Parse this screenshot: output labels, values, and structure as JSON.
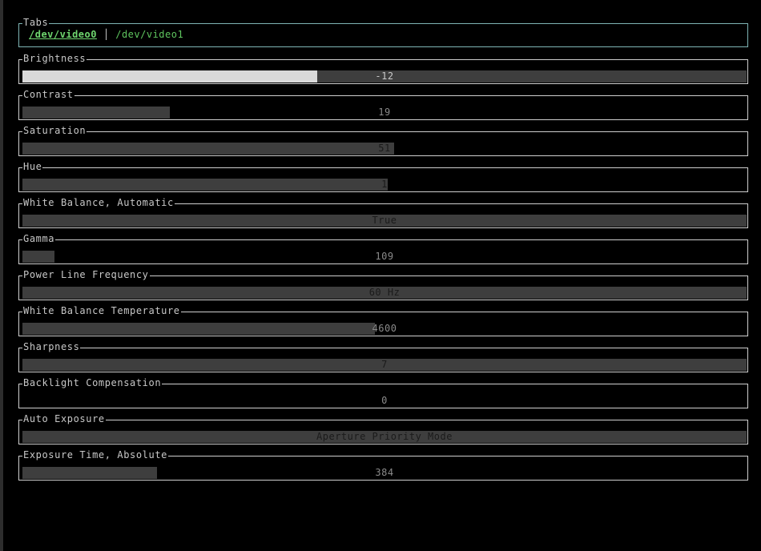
{
  "tabs": {
    "title": "Tabs",
    "items": [
      {
        "label": "/dev/video0",
        "active": true
      },
      {
        "label": "/dev/video1",
        "active": false
      }
    ]
  },
  "controls": [
    {
      "title": "Brightness",
      "value": "-12",
      "fill": 0.407
    },
    {
      "title": "Contrast",
      "value": "19",
      "fill": 0.204
    },
    {
      "title": "Saturation",
      "value": "51",
      "fill": 0.513
    },
    {
      "title": "Hue",
      "value": "1",
      "fill": 0.504
    },
    {
      "title": "White Balance, Automatic",
      "value": "True",
      "fill": 1.0
    },
    {
      "title": "Gamma",
      "value": "109",
      "fill": 0.044
    },
    {
      "title": "Power Line Frequency",
      "value": "60 Hz",
      "fill": 1.0
    },
    {
      "title": "White Balance Temperature",
      "value": "4600",
      "fill": 0.487
    },
    {
      "title": "Sharpness",
      "value": "7",
      "fill": 1.0
    },
    {
      "title": "Backlight Compensation",
      "value": "0",
      "fill": 0.0
    },
    {
      "title": "Auto Exposure",
      "value": "Aperture Priority Mode",
      "fill": 1.0
    },
    {
      "title": "Exposure Time, Absolute",
      "value": "384",
      "fill": 0.186
    }
  ],
  "colors": {
    "background": "#000000",
    "border": "#cfcfcf",
    "tabs_border": "#7fb5b5",
    "tab_text": "#5fc65f",
    "gauge_fill": "#3e3e3e",
    "gauge_fill_brightness": "#d9d9d9"
  }
}
